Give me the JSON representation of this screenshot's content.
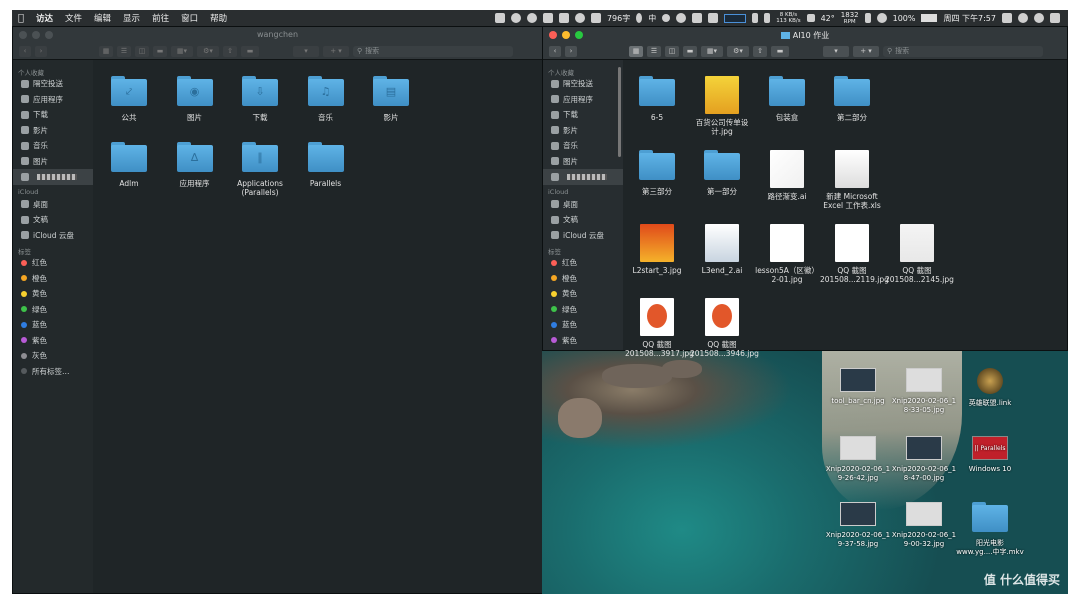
{
  "menubar": {
    "app": "访达",
    "items": [
      "文件",
      "编辑",
      "显示",
      "前往",
      "窗口",
      "帮助"
    ],
    "status": {
      "word_count": "796字",
      "ime": "中",
      "net_up": "8 KB/s",
      "net_down": "113 KB/s",
      "temp": "42°",
      "fan": "1832",
      "fan_unit": "RPM",
      "battery": "100%",
      "clock": "周四 下午7:57"
    }
  },
  "colors": {
    "red": "#fc5f57",
    "orange": "#f5a623",
    "yellow": "#f8d12f",
    "green": "#3ec24a",
    "blue": "#2f7de1",
    "purple": "#b85bd6",
    "gray": "#8e8e93"
  },
  "left_window": {
    "title": "wangchen",
    "search_placeholder": "搜索",
    "sidebar": {
      "favorites_header": "个人收藏",
      "favorites": [
        {
          "label": "隔空投送",
          "icon": "airdrop-icon"
        },
        {
          "label": "应用程序",
          "icon": "applications-icon"
        },
        {
          "label": "下载",
          "icon": "downloads-icon"
        },
        {
          "label": "影片",
          "icon": "movies-icon"
        },
        {
          "label": "音乐",
          "icon": "music-icon"
        },
        {
          "label": "图片",
          "icon": "pictures-icon"
        },
        {
          "label": "",
          "icon": "home-icon"
        }
      ],
      "icloud_header": "iCloud",
      "icloud": [
        {
          "label": "桌面",
          "icon": "desktop-icon"
        },
        {
          "label": "文稿",
          "icon": "documents-icon"
        },
        {
          "label": "iCloud 云盘",
          "icon": "cloud-icon"
        }
      ],
      "tags_header": "标签",
      "tags": [
        {
          "label": "红色",
          "color": "#fc5f57"
        },
        {
          "label": "橙色",
          "color": "#f5a623"
        },
        {
          "label": "黄色",
          "color": "#f8d12f"
        },
        {
          "label": "绿色",
          "color": "#3ec24a"
        },
        {
          "label": "蓝色",
          "color": "#2f7de1"
        },
        {
          "label": "紫色",
          "color": "#b85bd6"
        },
        {
          "label": "灰色",
          "color": "#8e8e93"
        },
        {
          "label": "所有标签…",
          "color": "#555a5d"
        }
      ]
    },
    "items": [
      {
        "label": "公共",
        "glyph": "public-folder-icon"
      },
      {
        "label": "图片",
        "glyph": "camera-icon"
      },
      {
        "label": "下载",
        "glyph": "download-icon"
      },
      {
        "label": "音乐",
        "glyph": "music-icon"
      },
      {
        "label": "影片",
        "glyph": "film-icon"
      },
      {
        "label": "Adlm",
        "glyph": ""
      },
      {
        "label": "应用程序",
        "glyph": "applications-icon"
      },
      {
        "label": "Applications\n(Parallels)",
        "glyph": "parallels-icon"
      },
      {
        "label": "Parallels",
        "glyph": ""
      }
    ]
  },
  "right_window": {
    "title": "AI10 作业",
    "search_placeholder": "搜索",
    "sidebar": {
      "favorites_header": "个人收藏",
      "favorites": [
        {
          "label": "隔空投送"
        },
        {
          "label": "应用程序"
        },
        {
          "label": "下载"
        },
        {
          "label": "影片"
        },
        {
          "label": "音乐"
        },
        {
          "label": "图片"
        },
        {
          "label": ""
        }
      ],
      "icloud_header": "iCloud",
      "icloud": [
        {
          "label": "桌面"
        },
        {
          "label": "文稿"
        },
        {
          "label": "iCloud 云盘"
        }
      ],
      "tags_header": "标签",
      "tags": [
        {
          "label": "红色",
          "color": "#fc5f57"
        },
        {
          "label": "橙色",
          "color": "#f5a623"
        },
        {
          "label": "黄色",
          "color": "#f8d12f"
        },
        {
          "label": "绿色",
          "color": "#3ec24a"
        },
        {
          "label": "蓝色",
          "color": "#2f7de1"
        },
        {
          "label": "紫色",
          "color": "#b85bd6"
        }
      ]
    },
    "items": [
      {
        "label": "6-5",
        "kind": "folder"
      },
      {
        "label": "百货公司传单设\n计.jpg",
        "kind": "file"
      },
      {
        "label": "包装盒",
        "kind": "folder"
      },
      {
        "label": "第二部分",
        "kind": "folder"
      },
      {
        "label": "第三部分",
        "kind": "folder"
      },
      {
        "label": "第一部分",
        "kind": "folder"
      },
      {
        "label": "路径渐变.ai",
        "kind": "file"
      },
      {
        "label": "新建 Microsoft\nExcel 工作表.xls",
        "kind": "file"
      },
      {
        "label": "L2start_3.jpg",
        "kind": "file"
      },
      {
        "label": "L3end_2.ai",
        "kind": "file"
      },
      {
        "label": "lesson5A（区徽）\n2-01.jpg",
        "kind": "file"
      },
      {
        "label": "QQ 截图\n201508...2119.jpg",
        "kind": "file"
      },
      {
        "label": "QQ 截图\n201508...2145.jpg",
        "kind": "file"
      },
      {
        "label": "QQ 截图\n201508...3917.jpg",
        "kind": "file"
      },
      {
        "label": "QQ 截图\n201508...3946.jpg",
        "kind": "file"
      }
    ]
  },
  "desktop": {
    "icons": [
      {
        "label": "tool_bar_cn.jpg"
      },
      {
        "label": "Xnip2020-02-06_1\n8-33-05.jpg"
      },
      {
        "label": "英雄联盟.link"
      },
      {
        "label": "Xnip2020-02-06_1\n9-26-42.jpg"
      },
      {
        "label": "Xnip2020-02-06_1\n8-47-00.jpg"
      },
      {
        "label": "Windows 10"
      },
      {
        "label": "Xnip2020-02-06_1\n9-37-58.jpg"
      },
      {
        "label": "Xnip2020-02-06_1\n9-00-32.jpg"
      },
      {
        "label": "阳光电影\nwww.yg....中字.mkv"
      }
    ],
    "parallels_badge": "|| Parallels",
    "watermark": "值 什么值得买"
  }
}
